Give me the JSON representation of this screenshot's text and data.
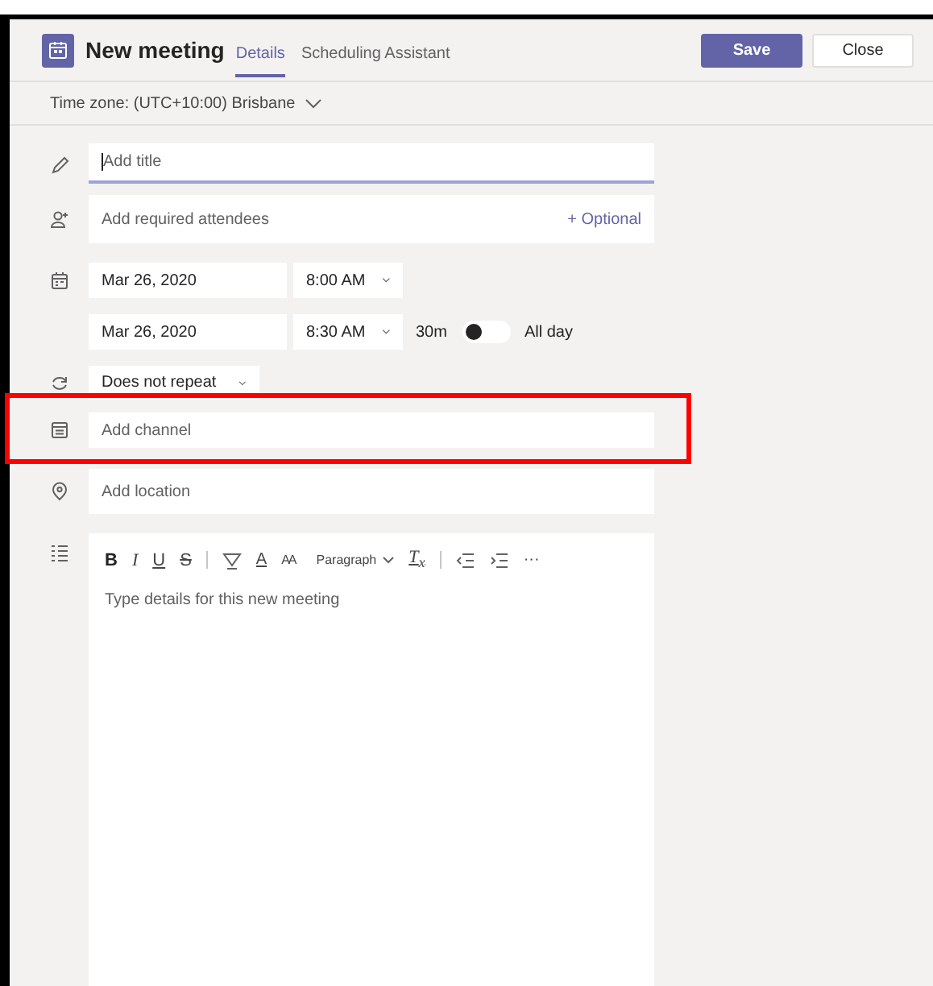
{
  "header": {
    "title": "New meeting",
    "tabs": [
      {
        "label": "Details",
        "selected": true
      },
      {
        "label": "Scheduling Assistant",
        "selected": false
      }
    ],
    "buttons": [
      {
        "label": "Save",
        "kind": "primary"
      },
      {
        "label": "Close",
        "kind": "secondary"
      }
    ]
  },
  "timezone": {
    "label": "Time zone: (UTC+10:00) Brisbane"
  },
  "form": [
    {
      "kind": "title",
      "placeholder": "Add title",
      "focused": true
    },
    {
      "kind": "attendees",
      "placeholder": "Add required attendees",
      "link": "+ Optional"
    },
    {
      "kind": "start",
      "date": "Mar 26, 2020",
      "time": "8:00 AM"
    },
    {
      "kind": "end",
      "date": "Mar 26, 2020",
      "time": "8:30 AM",
      "duration": "30m",
      "all_day": {
        "label": "All day",
        "on": false
      }
    },
    {
      "kind": "repeat",
      "value": "Does not repeat"
    },
    {
      "kind": "channel",
      "placeholder": "Add channel",
      "highlighted": true
    },
    {
      "kind": "location",
      "placeholder": "Add location"
    },
    {
      "kind": "details",
      "placeholder": "Type details for this new meeting",
      "toolbar": [
        {
          "kind": "bold",
          "label": "B"
        },
        {
          "kind": "italic",
          "label": "I"
        },
        {
          "kind": "underline",
          "label": "U"
        },
        {
          "kind": "strike",
          "label": "S"
        },
        {
          "kind": "separator"
        },
        {
          "kind": "highlight"
        },
        {
          "kind": "font-color",
          "label": "A"
        },
        {
          "kind": "font-size",
          "label": "AA"
        },
        {
          "kind": "dropdown",
          "label": "Paragraph"
        },
        {
          "kind": "clear",
          "label": "T$_{x}$"
        },
        {
          "kind": "separator"
        },
        {
          "kind": "outdent"
        },
        {
          "kind": "indent"
        },
        {
          "kind": "more",
          "label": "···"
        }
      ]
    }
  ]
}
